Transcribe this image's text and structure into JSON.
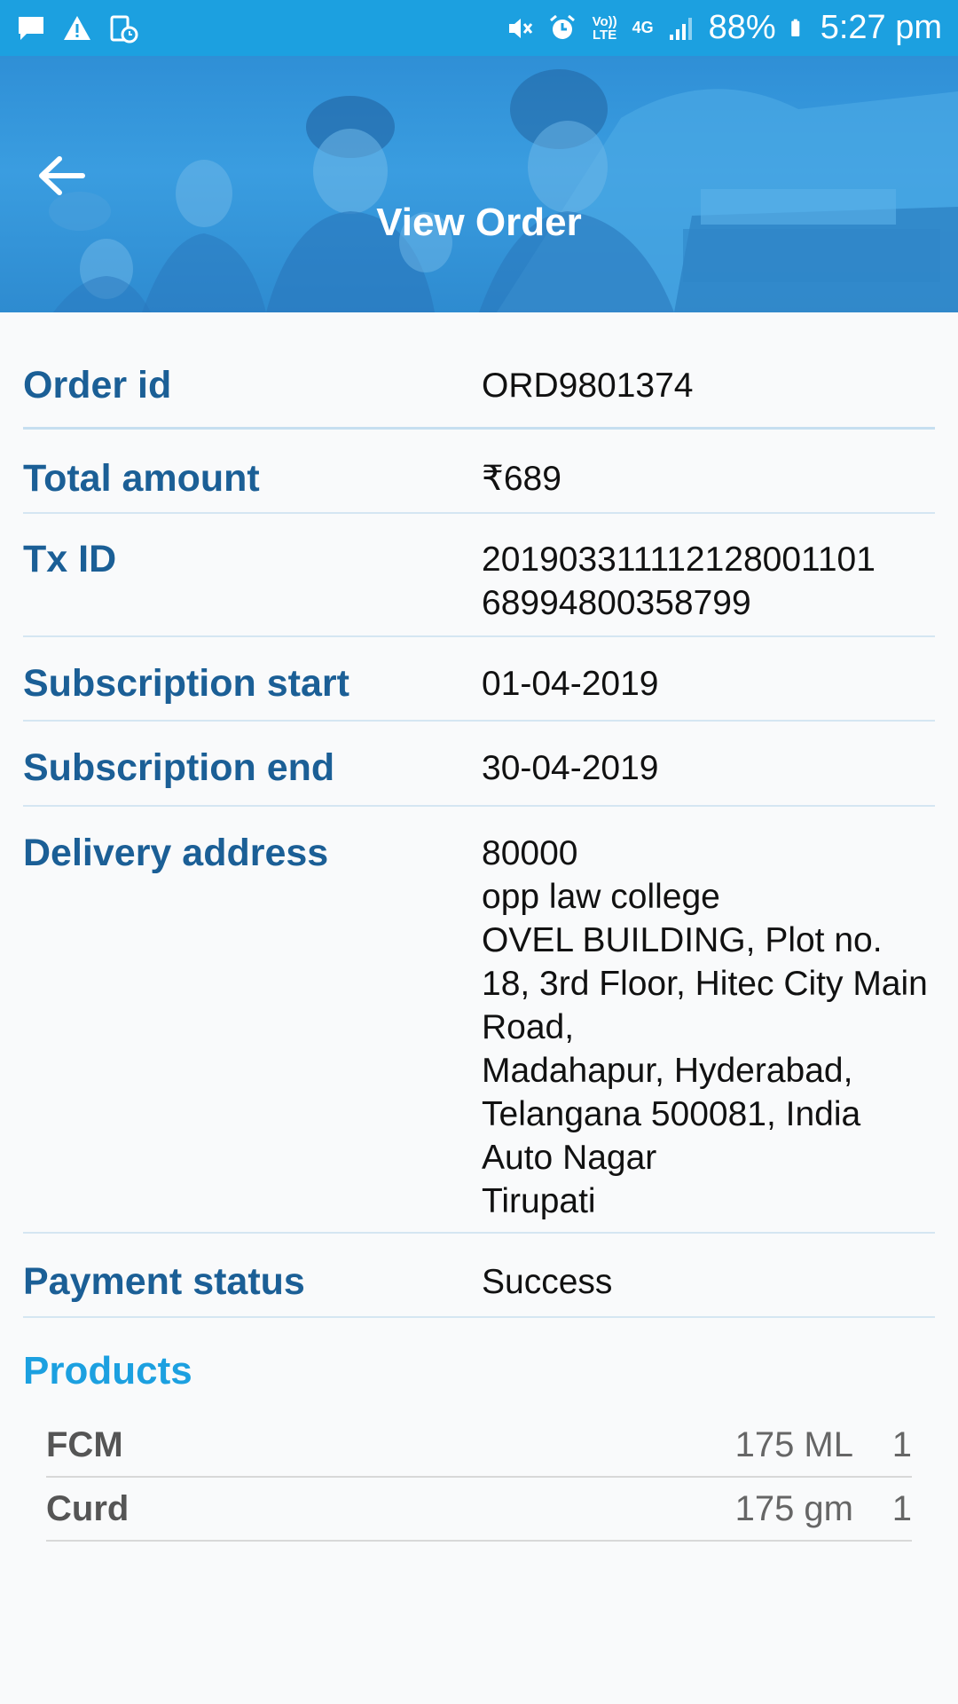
{
  "status_bar": {
    "battery": "88%",
    "time": "5:27 pm",
    "volte": "Vo)) LTE",
    "network": "4G",
    "icons": [
      "message-icon",
      "warning-icon",
      "clock-badge-icon",
      "mute-icon",
      "alarm-icon",
      "volte-icon",
      "4g-icon",
      "signal-icon",
      "battery-icon"
    ]
  },
  "header": {
    "title": "View Order",
    "back_icon": "arrow-left-icon"
  },
  "details": {
    "order_id": {
      "label": "Order id",
      "value": "ORD9801374"
    },
    "total_amount": {
      "label": "Total amount",
      "value": "₹689"
    },
    "tx_id": {
      "label": "Tx ID",
      "value": "201903311112128001101\n68994800358799"
    },
    "subscription_start": {
      "label": "Subscription start",
      "value": "01-04-2019"
    },
    "subscription_end": {
      "label": "Subscription end",
      "value": "30-04-2019"
    },
    "delivery_address": {
      "label": "Delivery address",
      "value": "80000\nopp law college\nOVEL BUILDING, Plot no. 18, 3rd Floor, Hitec City Main Road,\n Madahapur, Hyderabad, Telangana 500081, India\nAuto Nagar\nTirupati"
    },
    "payment_status": {
      "label": "Payment status",
      "value": "Success"
    }
  },
  "products": {
    "title": "Products",
    "items": [
      {
        "name": "FCM",
        "quantity": "175 ML",
        "count": "1"
      },
      {
        "name": "Curd",
        "quantity": "175 gm",
        "count": "1"
      }
    ]
  },
  "colors": {
    "status_bar": "#1ca0e0",
    "label": "#1b5f96",
    "products_title": "#1ca0e0"
  }
}
